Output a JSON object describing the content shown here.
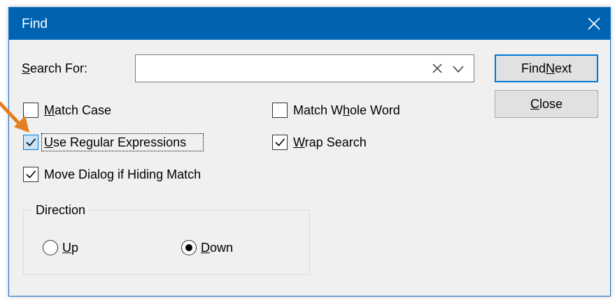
{
  "window": {
    "title": "Find"
  },
  "search": {
    "label": "Search For:",
    "label_underline_char": "S",
    "label_rest": "earch For:",
    "value": "",
    "placeholder": ""
  },
  "buttons": {
    "find_next_pre": "Find ",
    "find_next_u": "N",
    "find_next_post": "ext",
    "close_u": "C",
    "close_post": "lose"
  },
  "options": {
    "match_case": {
      "u": "M",
      "rest": "atch Case",
      "checked": false
    },
    "match_whole_word": {
      "pre": "Match W",
      "u": "h",
      "rest": "ole Word",
      "checked": false
    },
    "use_regex": {
      "u": "U",
      "rest": "se Regular Expressions",
      "checked": true
    },
    "wrap_search": {
      "u": "W",
      "rest": "rap Search",
      "checked": true
    },
    "move_dialog": {
      "text": "Move Dialog if Hiding Match",
      "checked": true
    }
  },
  "direction": {
    "label": "Direction",
    "up": {
      "u": "U",
      "rest": "p",
      "selected": false
    },
    "down": {
      "u": "D",
      "rest": "own",
      "selected": true
    }
  },
  "colors": {
    "title_bar": "#0063b1",
    "dialog_bg": "#f0f0f0",
    "focus_accent": "#0078d7",
    "annotation_arrow": "#e67e22"
  }
}
